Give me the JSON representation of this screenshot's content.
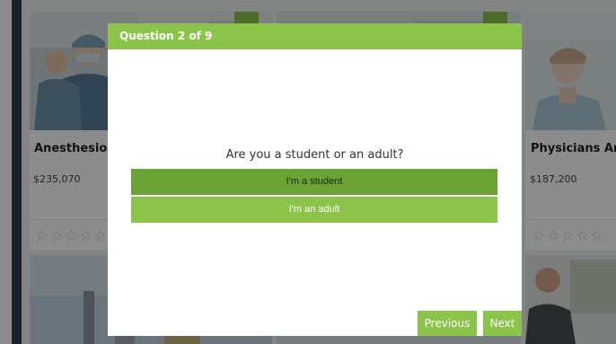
{
  "cards": [
    {
      "title": "Anesthesiolo",
      "salary": "$235,070",
      "stars": "☆☆☆☆☆"
    },
    {
      "title": "",
      "salary": "",
      "stars": ""
    },
    {
      "title": "Physicians And",
      "salary": "$187,200",
      "stars": "☆☆☆☆☆"
    }
  ],
  "modal": {
    "header": "Question 2 of 9",
    "question": "Are you a student or an adult?",
    "answers": [
      "I'm a student",
      "I'm an adult"
    ],
    "previous_label": "Previous",
    "next_label": "Next"
  },
  "colors": {
    "accent": "#8cc34a",
    "accent_dark": "#6aa334",
    "sidebar": "#2f3f49",
    "overlay": "rgba(0,0,0,0.45)"
  },
  "icons": [
    "gear-icon",
    "star-icon"
  ]
}
